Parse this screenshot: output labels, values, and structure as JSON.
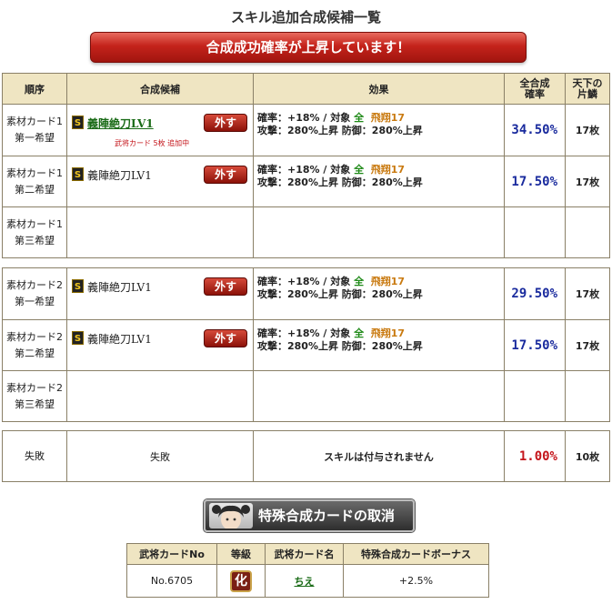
{
  "page_title": "スキル追加合成候補一覧",
  "banner_text": "合成成功確率が上昇しています！",
  "columns": {
    "order": "順序",
    "candidate": "合成候補",
    "effect": "効果",
    "rate": "全合成確率",
    "count": "天下の片鱗"
  },
  "groups": [
    {
      "rows": [
        {
          "order_line1": "素材カード1",
          "order_line2": "第一希望",
          "skill": "義陣絶刀LV1",
          "skill_linked": true,
          "remove_label": "外す",
          "note": "武将カード 5枚 追加中",
          "effect_line1_a": "確率：+18% / 対象 ",
          "effect_target": "全",
          "effect_skill": "飛翔17",
          "effect_line2": "攻撃：280%上昇 防御：280%上昇",
          "rate": "34.50%",
          "count": "17枚"
        },
        {
          "order_line1": "素材カード1",
          "order_line2": "第二希望",
          "skill": "義陣絶刀LV1",
          "skill_linked": false,
          "remove_label": "外す",
          "note": "",
          "effect_line1_a": "確率：+18% / 対象 ",
          "effect_target": "全",
          "effect_skill": "飛翔17",
          "effect_line2": "攻撃：280%上昇 防御：280%上昇",
          "rate": "17.50%",
          "count": "17枚"
        },
        {
          "order_line1": "素材カード1",
          "order_line2": "第三希望",
          "skill": "",
          "rate": "",
          "count": ""
        }
      ]
    },
    {
      "rows": [
        {
          "order_line1": "素材カード2",
          "order_line2": "第一希望",
          "skill": "義陣絶刀LV1",
          "skill_linked": false,
          "remove_label": "外す",
          "note": "",
          "effect_line1_a": "確率：+18% / 対象 ",
          "effect_target": "全",
          "effect_skill": "飛翔17",
          "effect_line2": "攻撃：280%上昇 防御：280%上昇",
          "rate": "29.50%",
          "count": "17枚"
        },
        {
          "order_line1": "素材カード2",
          "order_line2": "第二希望",
          "skill": "義陣絶刀LV1",
          "skill_linked": false,
          "remove_label": "外す",
          "note": "",
          "effect_line1_a": "確率：+18% / 対象 ",
          "effect_target": "全",
          "effect_skill": "飛翔17",
          "effect_line2": "攻撃：280%上昇 防御：280%上昇",
          "rate": "17.50%",
          "count": "17枚"
        },
        {
          "order_line1": "素材カード2",
          "order_line2": "第三希望",
          "skill": "",
          "rate": "",
          "count": ""
        }
      ]
    }
  ],
  "failure": {
    "order": "失敗",
    "candidate": "失敗",
    "effect": "スキルは付与されません",
    "rate": "1.00%",
    "count": "10枚"
  },
  "cancel_button_label": "特殊合成カードの取消",
  "bonus_table": {
    "headers": [
      "武将カードNo",
      "等級",
      "武将カード名",
      "特殊合成カードボーナス"
    ],
    "row": {
      "card_no": "No.6705",
      "rank": "化",
      "card_name": "ちえ",
      "bonus": "+2.5%"
    }
  },
  "colors": {
    "header_bg": "#efe5c2",
    "rate_blue": "#1a2b9e",
    "fail_red": "#c4141a",
    "banner_red": "#c4231b"
  }
}
